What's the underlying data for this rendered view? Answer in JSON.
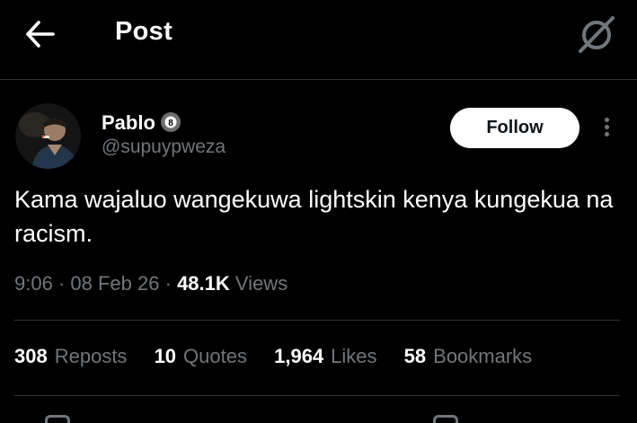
{
  "header": {
    "title": "Post",
    "back_icon": "arrow-left-icon",
    "grok_icon": "grok-slash-icon"
  },
  "post": {
    "author": {
      "name": "Pablo",
      "badge_icon": "eight-ball-icon",
      "handle": "@supuypweza",
      "avatar_icon": "avatar-photo"
    },
    "follow_label": "Follow",
    "text": "Kama wajaluo wangekuwa lightskin kenya kungekua na racism.",
    "time": "9:06",
    "date": "08 Feb 26",
    "views_count": "48.1K",
    "views_label": "Views",
    "separator": "·"
  },
  "stats": [
    {
      "count": "308",
      "label": "Reposts"
    },
    {
      "count": "10",
      "label": "Quotes"
    },
    {
      "count": "1,964",
      "label": "Likes"
    },
    {
      "count": "58",
      "label": "Bookmarks"
    }
  ],
  "colors": {
    "background": "#000000",
    "text_primary": "#ffffff",
    "text_secondary": "#71767b",
    "divider": "#2f3336",
    "follow_bg": "#ffffff",
    "follow_text": "#0f1419"
  }
}
